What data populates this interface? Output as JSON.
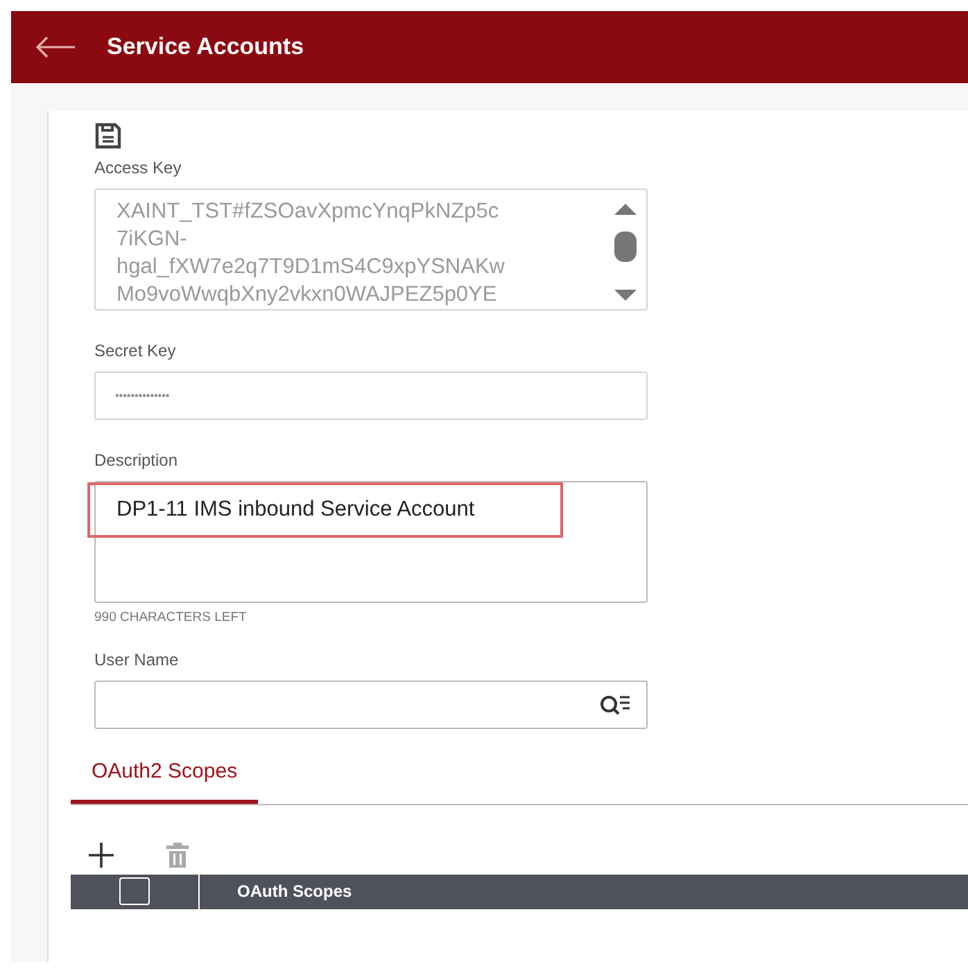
{
  "header": {
    "title": "Service Accounts"
  },
  "fields": [
    {
      "kind": "scrolltext",
      "label": "Access Key",
      "lines": [
        "XAINT_TST#fZSOavXpmcYnqPkNZp5c",
        "7iKGN-",
        "hgal_fXW7e2q7T9D1mS4C9xpYSNAKw",
        "Mo9voWwqbXny2vkxn0WAJPEZ5p0YE"
      ]
    },
    {
      "kind": "password",
      "label": "Secret Key",
      "value": "••••••••••••••"
    },
    {
      "kind": "textarea",
      "label": "Description",
      "value": "DP1-11 IMS inbound Service Account",
      "highlighted": true,
      "hint": "990 CHARACTERS LEFT"
    },
    {
      "kind": "lookup",
      "label": "User Name"
    }
  ],
  "tabs": [
    {
      "label": "OAuth2 Scopes",
      "selected": true
    }
  ],
  "toolbar": {
    "delete_disabled": true
  },
  "table": {
    "select_all_checked": false,
    "columns": [
      "OAuth Scopes"
    ]
  }
}
